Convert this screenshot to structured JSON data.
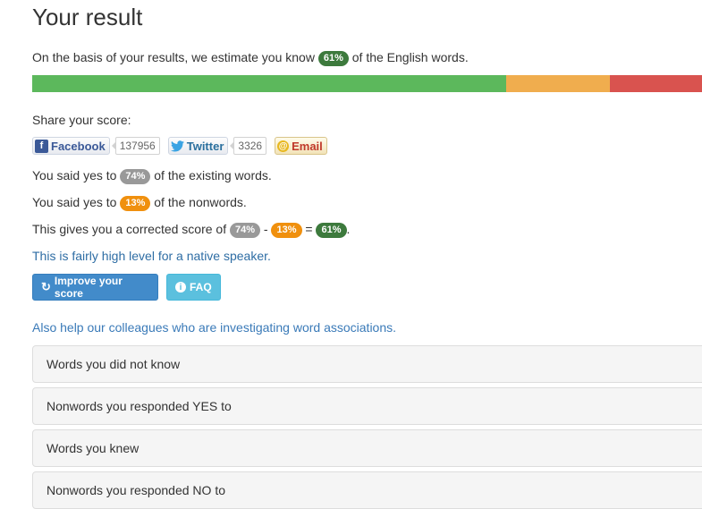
{
  "title": "Your result",
  "estimate": {
    "prefix": "On the basis of your results, we estimate you know",
    "badge": "61%",
    "suffix": "of the English words."
  },
  "progress": [
    {
      "name": "known",
      "fraction": 0.708,
      "color": "#5cb85c"
    },
    {
      "name": "yes-to-nonwords",
      "fraction": 0.154,
      "color": "#f0ad4e"
    },
    {
      "name": "unknown",
      "fraction": 0.138,
      "color": "#d9534f"
    }
  ],
  "share": {
    "label": "Share your score:",
    "facebook": {
      "label": "Facebook",
      "count": "137956"
    },
    "twitter": {
      "label": "Twitter",
      "count": "3326"
    },
    "email": {
      "label": "Email"
    }
  },
  "yes_words": {
    "prefix": "You said yes to",
    "badge": "74%",
    "suffix": "of the existing words."
  },
  "yes_nonwords": {
    "prefix": "You said yes to",
    "badge": "13%",
    "suffix": "of the nonwords."
  },
  "corrected": {
    "prefix": "This gives you a corrected score of",
    "a": "74%",
    "minus": "-",
    "b": "13%",
    "eq": "=",
    "result": "61%",
    "end": "."
  },
  "level_text": "This is fairly high level for a native speaker.",
  "buttons": {
    "improve": "Improve your score",
    "faq": "FAQ"
  },
  "associations_link": "Also help our colleagues who are investigating word associations.",
  "panels": [
    "Words you did not know",
    "Nonwords you responded YES to",
    "Words you knew",
    "Nonwords you responded NO to"
  ],
  "colors": {
    "green_badge": "#3d7a3d",
    "gray_badge": "#999999",
    "orange_badge": "#f0900e",
    "primary": "#428bca",
    "info": "#5bc0de"
  }
}
